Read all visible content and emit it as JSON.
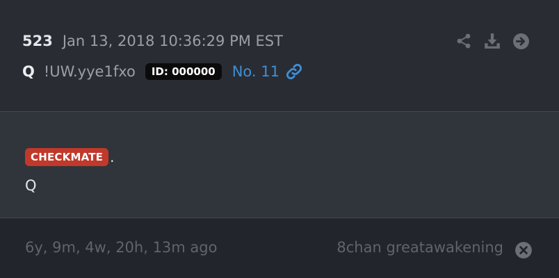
{
  "post": {
    "count": "523",
    "date": "Jan 13, 2018 10:36:29 PM EST",
    "author": "Q",
    "tripcode": "!UW.yye1fxo",
    "id_badge": "ID: 000000",
    "number": "No. 11"
  },
  "actions": {
    "icons": [
      "share-icon",
      "download-icon",
      "arrow-right-circle-icon"
    ]
  },
  "message": {
    "badge": "CHECKMATE",
    "badge_color": "#c0392b",
    "trailing": ".",
    "signature": "Q"
  },
  "footer": {
    "ago": "6y, 9m, 4w, 20h, 13m ago",
    "source": "8chan greatawakening"
  },
  "colors": {
    "link": "#3e8fd6",
    "background": "#22252b"
  }
}
